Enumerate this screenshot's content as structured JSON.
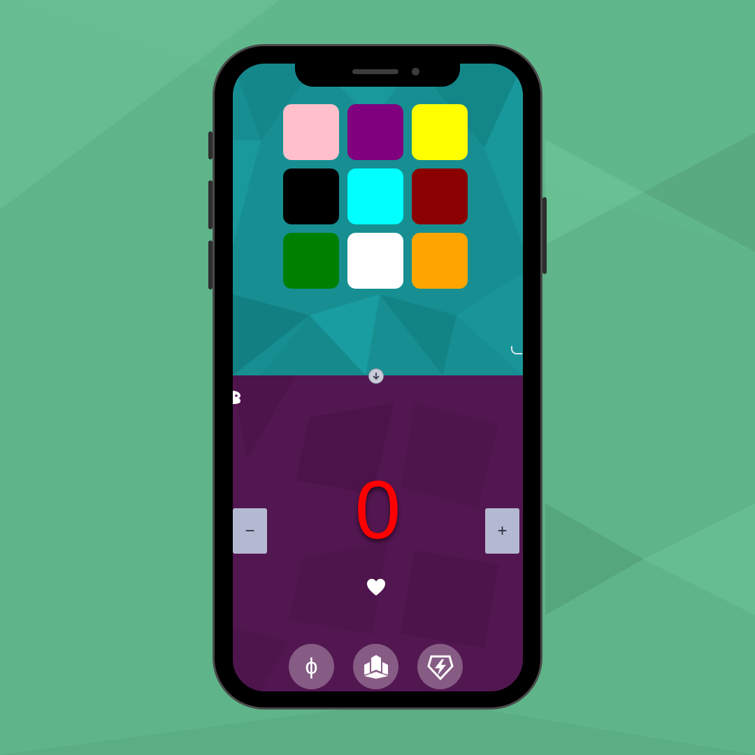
{
  "colors": {
    "background": "#5fb489",
    "top_panel": "#178f92",
    "bottom_panel": "#521650",
    "counter_text": "#ff0000"
  },
  "palette": [
    {
      "name": "pink",
      "color": "#ffc0cb"
    },
    {
      "name": "purple",
      "color": "#800080"
    },
    {
      "name": "yellow",
      "color": "#ffff00"
    },
    {
      "name": "black",
      "color": "#000000"
    },
    {
      "name": "cyan",
      "color": "#00ffff"
    },
    {
      "name": "dark-red",
      "color": "#8b0000"
    },
    {
      "name": "green",
      "color": "#008000"
    },
    {
      "name": "white",
      "color": "#ffffff"
    },
    {
      "name": "orange",
      "color": "#ffa500"
    }
  ],
  "counter": {
    "value": "0",
    "decrement_label": "−",
    "increment_label": "+"
  },
  "icons": {
    "swap": "arrow-down-circle-icon",
    "life": "heart-icon",
    "tools": [
      "phi-icon",
      "castle-icon",
      "lightning-shield-icon"
    ]
  },
  "toolbar": {
    "phi_label": "ϕ"
  }
}
